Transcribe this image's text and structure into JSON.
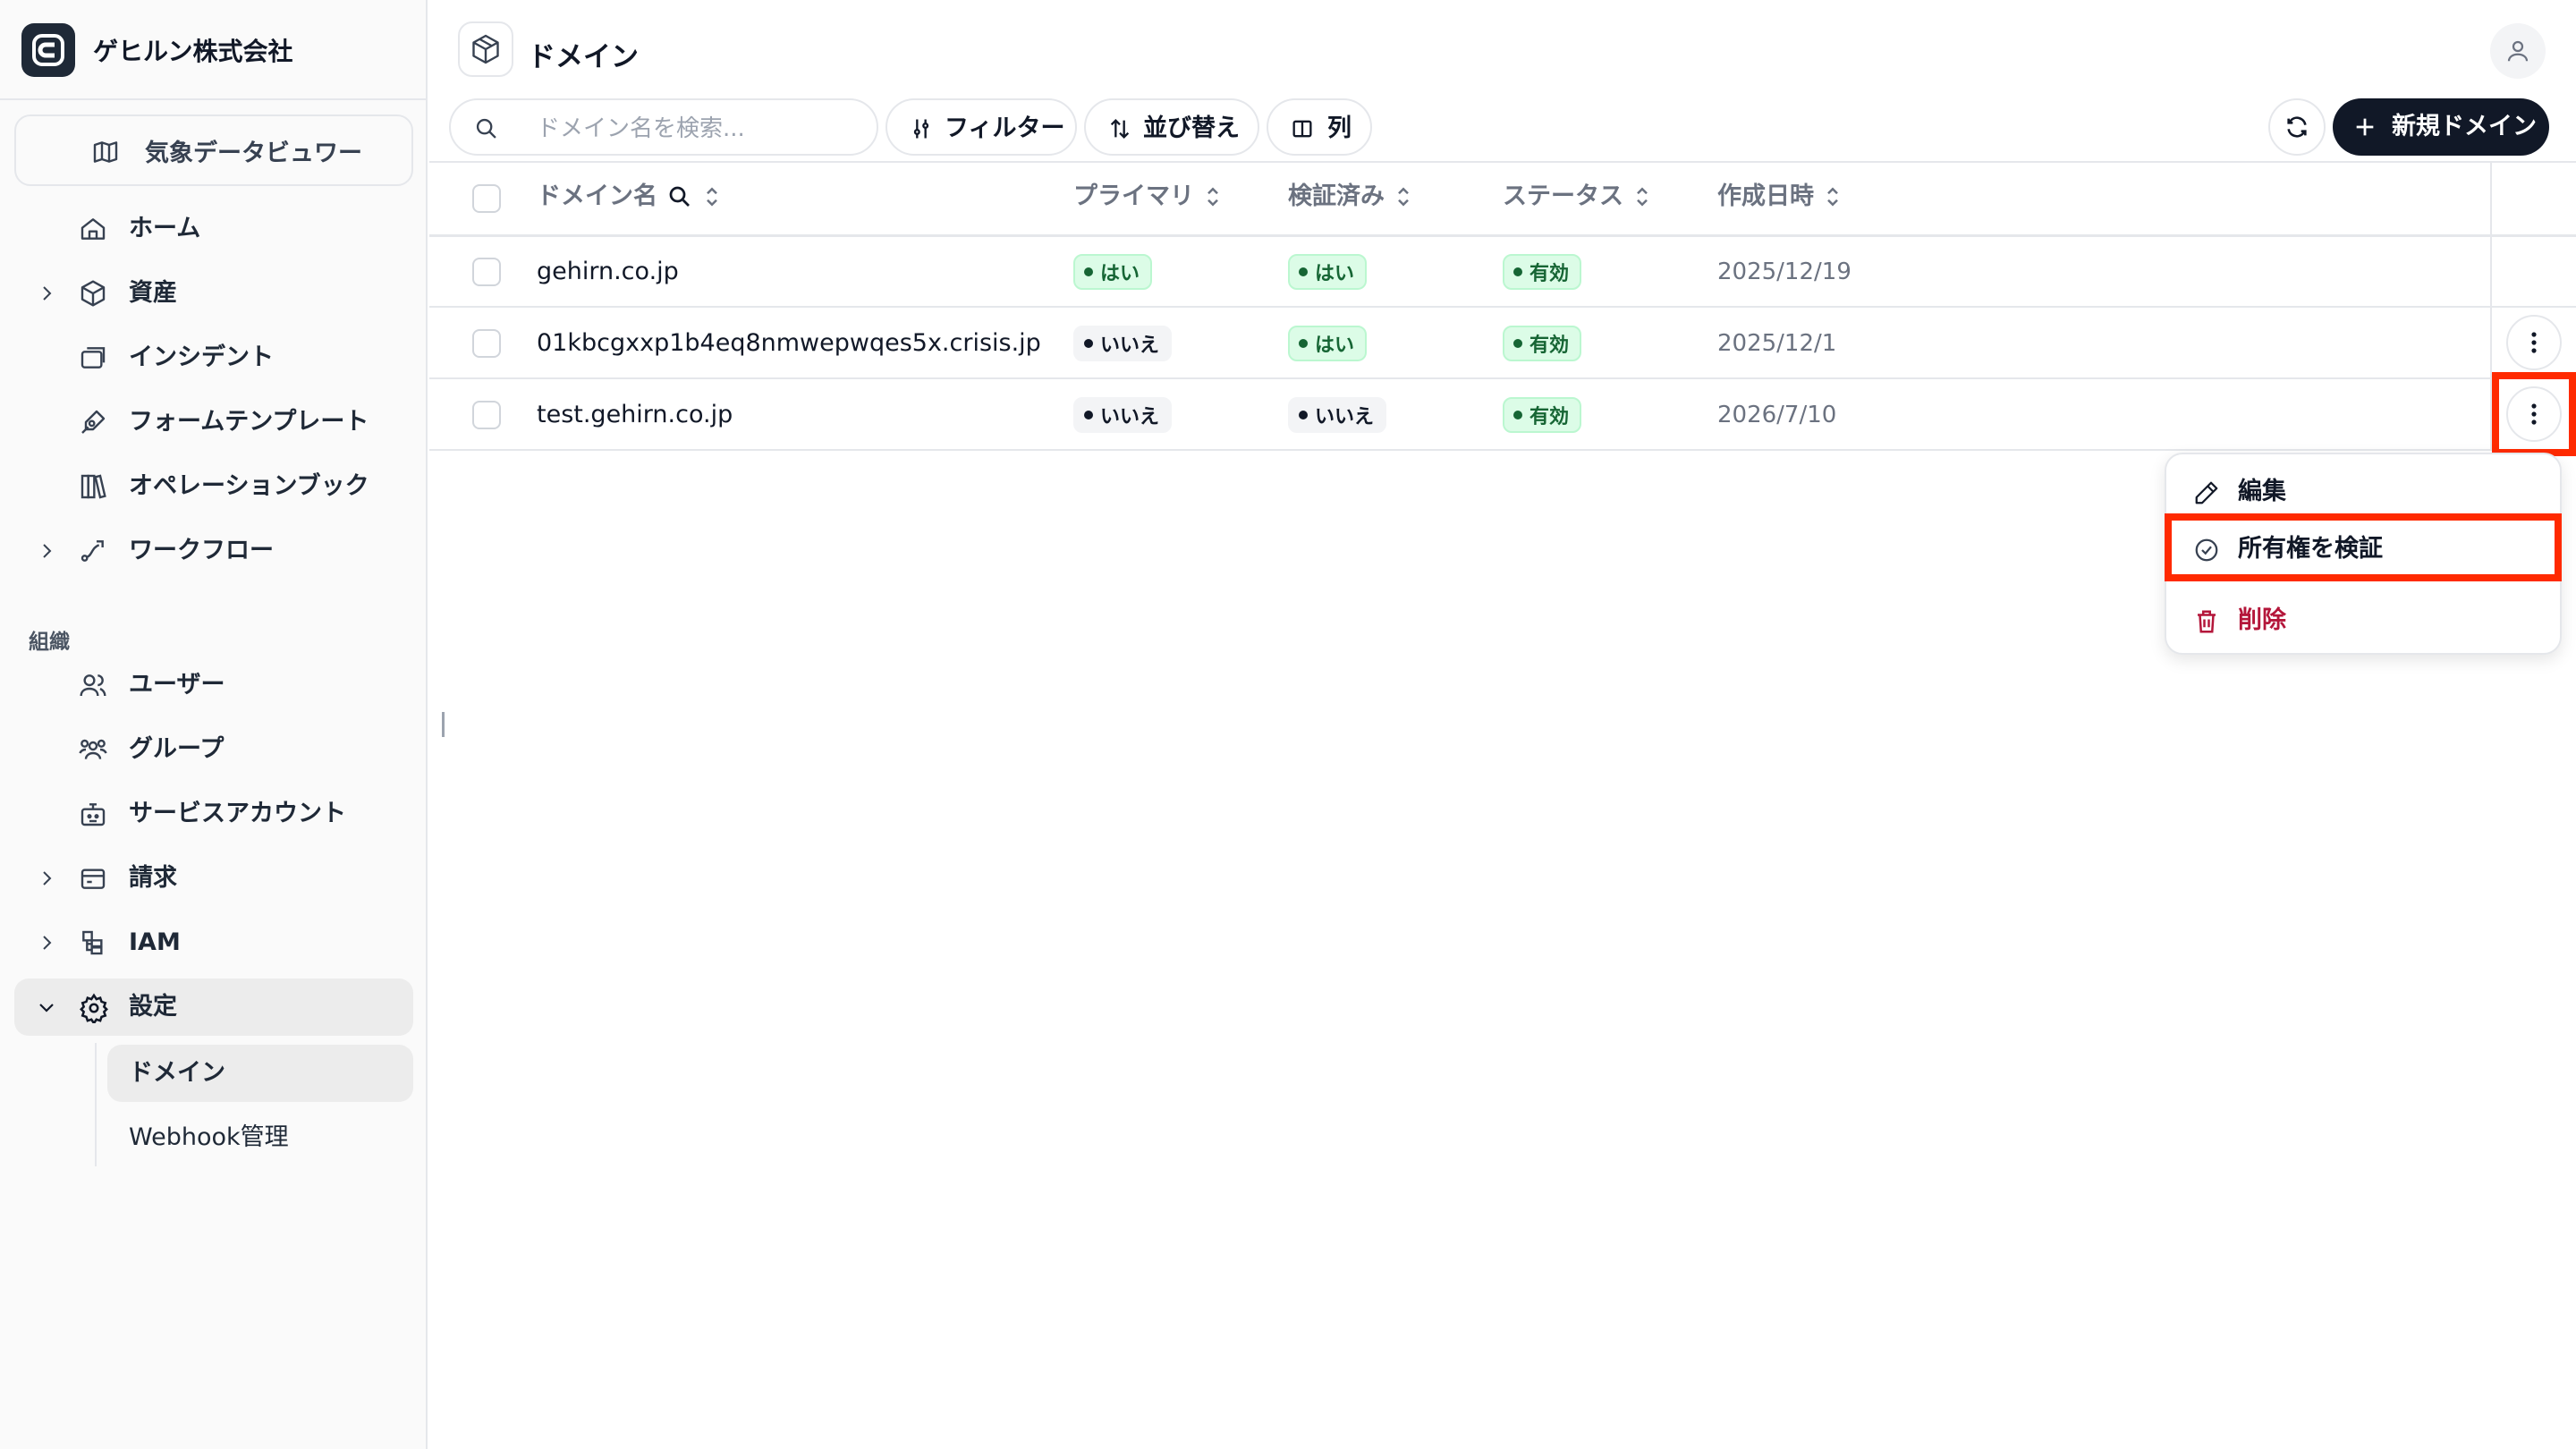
{
  "sidebar": {
    "company": "ゲヒルン株式会社",
    "viewer_label": "気象データビュワー",
    "items": [
      {
        "label": "ホーム",
        "icon": "home-icon"
      },
      {
        "label": "資産",
        "icon": "cube-icon"
      },
      {
        "label": "インシデント",
        "icon": "window-stack-icon"
      },
      {
        "label": "フォームテンプレート",
        "icon": "pen-tool-icon"
      },
      {
        "label": "オペレーションブック",
        "icon": "books-icon"
      },
      {
        "label": "ワークフロー",
        "icon": "workflow-icon"
      }
    ],
    "section_label": "組織",
    "org_items": [
      {
        "label": "ユーザー",
        "icon": "users-icon"
      },
      {
        "label": "グループ",
        "icon": "group-icon"
      },
      {
        "label": "サービスアカウント",
        "icon": "bot-icon"
      },
      {
        "label": "請求",
        "icon": "wallet-icon"
      },
      {
        "label": "IAM",
        "icon": "iam-icon"
      },
      {
        "label": "設定",
        "icon": "gear-icon"
      }
    ],
    "settings_sub": [
      {
        "label": "ドメイン",
        "active": true
      },
      {
        "label": "Webhook管理",
        "active": false
      }
    ]
  },
  "header": {
    "title": "ドメイン",
    "title_icon": "package-icon"
  },
  "toolbar": {
    "search_placeholder": "ドメイン名を検索...",
    "filter_label": "フィルター",
    "sort_label": "並び替え",
    "columns_label": "列",
    "new_label": "新規ドメイン"
  },
  "table": {
    "columns": [
      "ドメイン名",
      "プライマリ",
      "検証済み",
      "ステータス",
      "作成日時"
    ],
    "rows": [
      {
        "domain": "gehirn.co.jp",
        "primary": "はい",
        "verified": "はい",
        "status": "有効",
        "created": "2025/12/19"
      },
      {
        "domain": "01kbcgxxp1b4eq8nmwepwqes5x.crisis.jp",
        "primary": "いいえ",
        "verified": "はい",
        "status": "有効",
        "created": "2025/12/1"
      },
      {
        "domain": "test.gehirn.co.jp",
        "primary": "いいえ",
        "verified": "いいえ",
        "status": "有効",
        "created": "2026/7/10"
      }
    ]
  },
  "row_menu": {
    "items": [
      {
        "label": "編集",
        "icon": "pencil-icon"
      },
      {
        "label": "所有権を検証",
        "icon": "check-circle-icon"
      },
      {
        "label": "削除",
        "icon": "trash-icon"
      }
    ]
  },
  "colors": {
    "accent_dark": "#111827",
    "badge_green_bg": "#dcfce7",
    "badge_green_text": "#166534",
    "danger": "#b4163a",
    "highlight": "#ff2a00"
  }
}
